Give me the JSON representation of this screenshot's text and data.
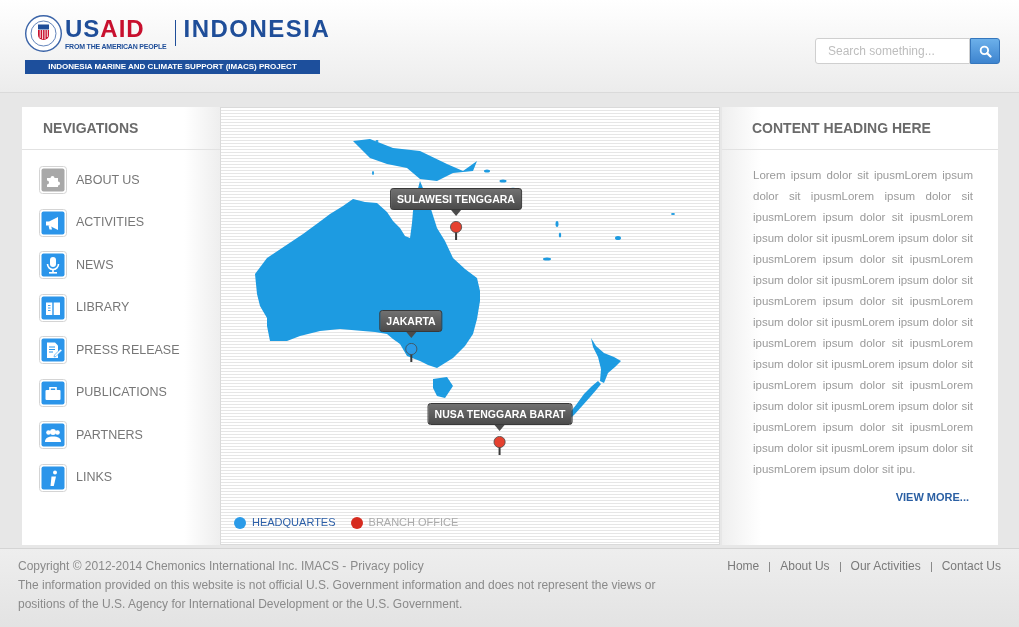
{
  "header": {
    "logo": {
      "agency_name_parts": [
        "US",
        "AID"
      ],
      "tagline": "FROM THE AMERICAN PEOPLE",
      "country": "INDONESIA",
      "project": "INDONESIA MARINE AND CLIMATE SUPPORT (IMACS) PROJECT"
    },
    "search": {
      "placeholder": "Search something..."
    }
  },
  "navigation": {
    "title": "NEVIGATIONS",
    "items": [
      {
        "label": "ABOUT US",
        "selected": true
      },
      {
        "label": "ACTIVITIES",
        "selected": false
      },
      {
        "label": "NEWS",
        "selected": false
      },
      {
        "label": "LIBRARY",
        "selected": false
      },
      {
        "label": "PRESS RELEASE",
        "selected": false
      },
      {
        "label": "PUBLICATIONS",
        "selected": false
      },
      {
        "label": "PARTNERS",
        "selected": false
      },
      {
        "label": "LINKS",
        "selected": false
      }
    ]
  },
  "map": {
    "markers": [
      {
        "label": "SULAWESI TENGGARA",
        "color": "#e5412f"
      },
      {
        "label": "JAKARTA",
        "color": "#2b9be8"
      },
      {
        "label": "NUSA TENGGARA BARAT",
        "color": "#e5412f"
      }
    ],
    "legend": [
      {
        "label": "HEADQUARTES",
        "color": "#2b9be8",
        "kind": "headquarters"
      },
      {
        "label": "BRANCH OFFICE",
        "color": "#d62b1f",
        "kind": "branch"
      }
    ]
  },
  "content": {
    "title": "CONTENT HEADING HERE",
    "body": "Lorem ipsum dolor sit ipusmLorem ipsum dolor sit ipusmLorem ipsum dolor sit ipusmLorem ipsum dolor sit ipusmLorem ipsum dolor sit ipusmLorem ipsum dolor sit ipusmLorem ipsum dolor sit ipusmLorem ipsum dolor sit ipusmLorem ipsum dolor sit ipusmLorem ipsum dolor sit ipusmLorem ipsum dolor sit ipusmLorem ipsum dolor sit ipusmLorem ipsum dolor sit ipusmLorem ipsum dolor sit ipusmLorem ipsum dolor sit ipusmLorem ipsum dolor sit ipusmLorem ipsum dolor sit ipusmLorem ipsum dolor sit ipusmLorem ipsum dolor sit ipusmLorem ipsum dolor sit ipusmLorem ipsum dolor sit ipusmLorem ipsum dolor sit ipu.",
    "link": "VIEW MORE..."
  },
  "footer": {
    "copyright": "Copyright © 2012-2014 Chemonics International Inc. IMACS -",
    "privacy_link": "Privacy policy",
    "disclaimer": "The information provided on this website is not official U.S. Government information and does not represent the views or positions of the U.S. Agency for International Development or the U.S. Government.",
    "links": [
      "Home",
      "About Us",
      "Our Activities",
      "Contact Us"
    ]
  }
}
